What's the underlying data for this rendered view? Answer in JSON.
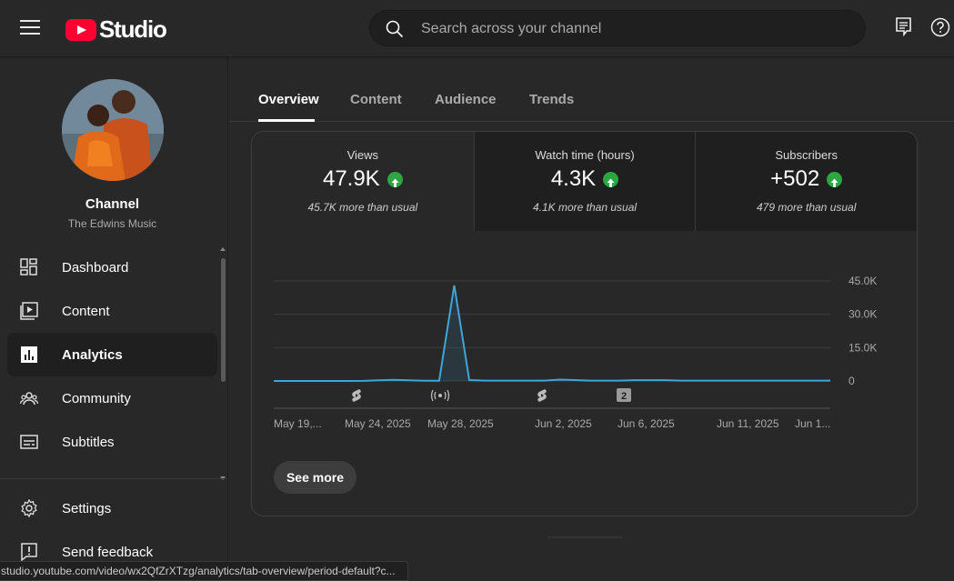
{
  "header": {
    "logo_text": "Studio",
    "search_placeholder": "Search across your channel"
  },
  "channel": {
    "title": "Channel",
    "name": "The Edwins Music"
  },
  "sidebar": {
    "items": [
      {
        "label": "Dashboard",
        "icon": "dashboard-icon"
      },
      {
        "label": "Content",
        "icon": "content-icon"
      },
      {
        "label": "Analytics",
        "icon": "analytics-icon",
        "active": true
      },
      {
        "label": "Community",
        "icon": "community-icon"
      },
      {
        "label": "Subtitles",
        "icon": "subtitles-icon"
      }
    ],
    "bottom_items": [
      {
        "label": "Settings",
        "icon": "gear-icon"
      },
      {
        "label": "Send feedback",
        "icon": "feedback-icon"
      }
    ]
  },
  "tabs": [
    {
      "label": "Overview",
      "active": true
    },
    {
      "label": "Content"
    },
    {
      "label": "Audience"
    },
    {
      "label": "Trends"
    }
  ],
  "metrics": [
    {
      "label": "Views",
      "value": "47.9K",
      "note": "45.7K more than usual"
    },
    {
      "label": "Watch time (hours)",
      "value": "4.3K",
      "note": "4.1K more than usual"
    },
    {
      "label": "Subscribers",
      "value": "+502",
      "note": "479 more than usual"
    }
  ],
  "chart_data": {
    "type": "area",
    "y_ticks": [
      "45.0K",
      "30.0K",
      "15.0K",
      "0"
    ],
    "ylim": [
      0,
      45000
    ],
    "x_tick_labels": [
      "May 19,...",
      "May 24, 2025",
      "May 28, 2025",
      "Jun 2, 2025",
      "Jun 6, 2025",
      "Jun 11, 2025",
      "Jun 1..."
    ],
    "series": [
      {
        "values": [
          0,
          0,
          0,
          0,
          0,
          0,
          50,
          300,
          500,
          300,
          100,
          100,
          43000,
          400,
          150,
          150,
          150,
          150,
          150,
          600,
          400,
          150,
          150,
          150,
          350,
          350,
          350,
          150,
          150,
          150,
          150,
          150,
          150,
          150,
          150,
          150,
          150,
          150
        ]
      }
    ],
    "markers": [
      {
        "type": "short",
        "icon": "shorts-icon"
      },
      {
        "type": "live",
        "icon": "live-icon"
      },
      {
        "type": "short",
        "icon": "shorts-icon"
      },
      {
        "type": "count",
        "label": "2"
      }
    ],
    "color": "#3ea6d8"
  },
  "see_more_label": "See more",
  "status_url": "studio.youtube.com/video/wx2QfZrXTzg/analytics/tab-overview/period-default?c..."
}
